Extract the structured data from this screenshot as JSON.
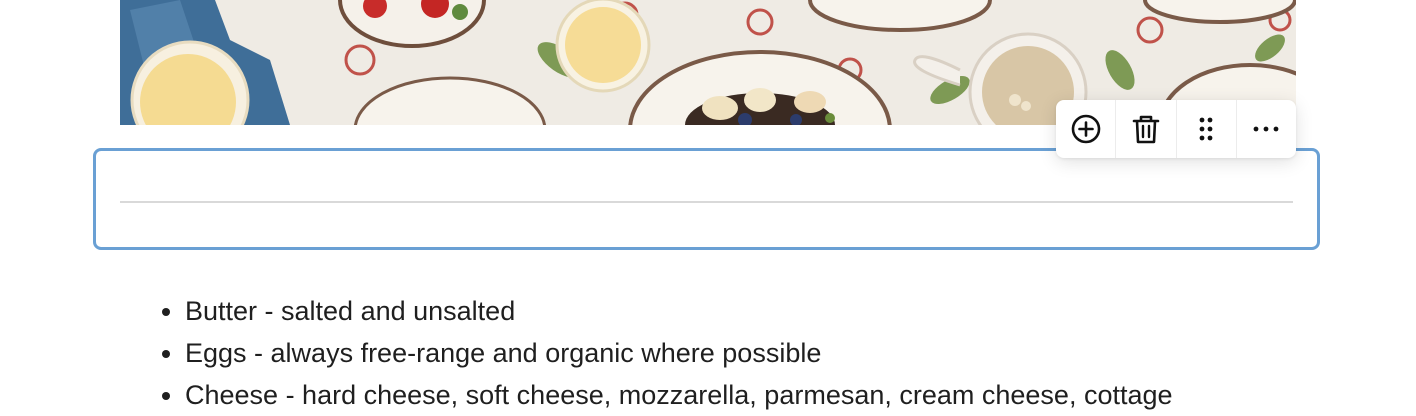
{
  "image": {
    "alt": "Breakfast table with plates, juice glasses and strawberries",
    "colors": {
      "tablecloth": "#f1eee8",
      "napkin_blue": "#3e6a93",
      "juice": "#f7df97",
      "plate_rim": "#7a5a48"
    }
  },
  "selected_block": {
    "type": "separator",
    "border_color": "#6aa0d4"
  },
  "toolbar": {
    "buttons": [
      {
        "icon": "plus-circle-icon",
        "label": "Add block"
      },
      {
        "icon": "trash-icon",
        "label": "Delete"
      },
      {
        "icon": "drag-handle-icon",
        "label": "Move"
      },
      {
        "icon": "more-horizontal-icon",
        "label": "More options"
      }
    ]
  },
  "list": {
    "items": [
      "Butter - salted and unsalted",
      "Eggs - always free-range and organic where possible",
      "Cheese - hard cheese, soft cheese, mozzarella, parmesan, cream cheese, cottage"
    ]
  }
}
